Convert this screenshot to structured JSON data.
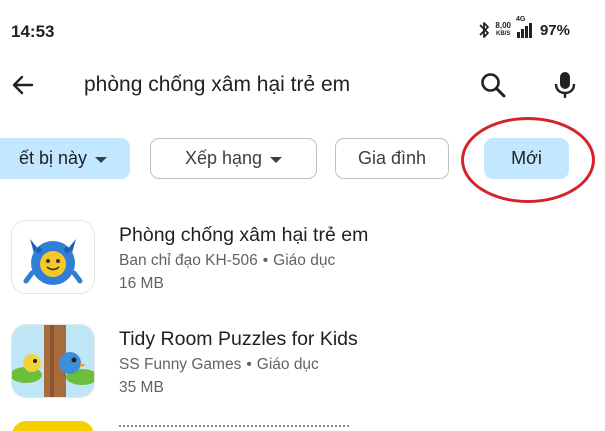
{
  "status_bar": {
    "time": "14:53",
    "net_speed_value": "8,00",
    "net_speed_unit": "KB/S",
    "network_type": "4G",
    "battery_percent": "97%",
    "icons": [
      "bluetooth-icon",
      "signal-icon"
    ]
  },
  "search": {
    "query": "phòng chống xâm hại trẻ em",
    "icons": [
      "back-arrow-icon",
      "search-icon",
      "mic-icon"
    ]
  },
  "filters": {
    "chips": [
      {
        "label": "ết bị này",
        "selected": true,
        "dropdown": true
      },
      {
        "label": "Xếp hạng",
        "selected": false,
        "dropdown": true
      },
      {
        "label": "Gia đình",
        "selected": false,
        "dropdown": false
      },
      {
        "label": "Mới",
        "selected": true,
        "dropdown": false
      }
    ],
    "annotation_color": "#d3232c"
  },
  "apps": [
    {
      "title": "Phòng chống xâm hại trẻ em",
      "developer": "Ban chỉ đạo KH-506",
      "category": "Giáo dục",
      "size": "16 MB",
      "icon": "blue-monster-mascot-icon"
    },
    {
      "title": "Tidy Room Puzzles for Kids",
      "developer": "SS Funny Games",
      "category": "Giáo dục",
      "size": "35 MB",
      "icon": "birds-on-tree-icon"
    }
  ],
  "colors": {
    "selected_chip": "#c2e7ff",
    "chip_border": "#bdc1c6",
    "text_primary": "#202124",
    "text_secondary": "#5f6368"
  }
}
